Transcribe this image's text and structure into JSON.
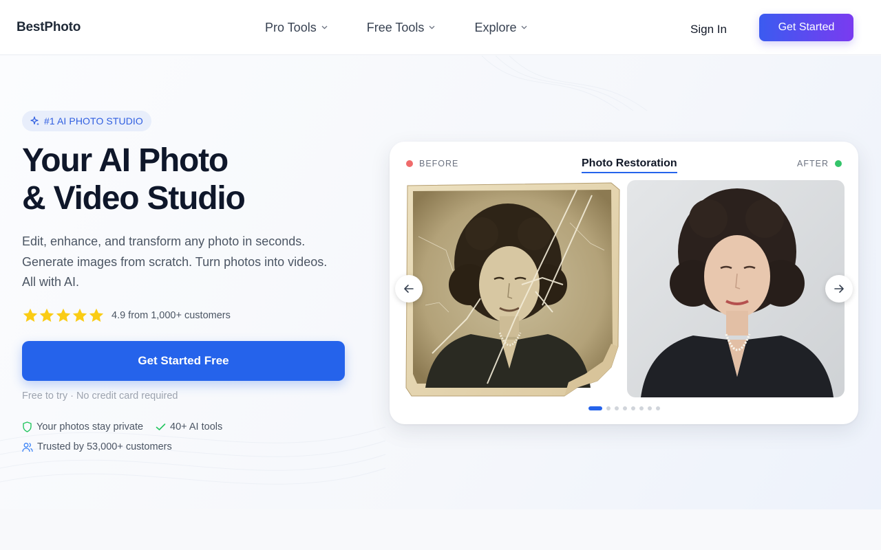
{
  "nav": {
    "logo": "BestPhoto",
    "menu": [
      {
        "label": "Pro Tools"
      },
      {
        "label": "Free Tools"
      },
      {
        "label": "Explore"
      }
    ],
    "sign_in": "Sign In",
    "get_started": "Get Started"
  },
  "hero": {
    "badge": "#1 AI PHOTO STUDIO",
    "headline_line1": "Your AI Photo",
    "headline_line2": "& Video Studio",
    "subtitle": "Edit, enhance, and transform any photo in seconds. Generate images from scratch. Turn photos into videos. All with AI.",
    "rating": {
      "stars": 5,
      "text": "4.9 from 1,000+ customers"
    },
    "cta": "Get Started Free",
    "note": "Free to try · No credit card required",
    "trust": [
      {
        "icon": "shield-icon",
        "text": "Your photos stay private"
      },
      {
        "icon": "check-icon",
        "text": "40+ AI tools"
      },
      {
        "icon": "users-icon",
        "text": "Trusted by 53,000+ customers"
      }
    ]
  },
  "showcase": {
    "before_label": "BEFORE",
    "after_label": "AFTER",
    "title": "Photo Restoration",
    "slide_count": 8,
    "active_slide": 1
  },
  "colors": {
    "primary": "#2563eb",
    "gradient_start": "#3b5bf0",
    "gradient_end": "#7a3bf0",
    "star": "#facc15",
    "before_dot": "#ef6b6b",
    "after_dot": "#34c46a",
    "headline": "#0f172a"
  }
}
